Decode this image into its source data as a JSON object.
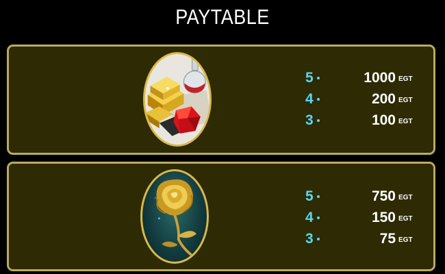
{
  "title": "PAYTABLE",
  "colors": {
    "background": "#000000",
    "panel": "#2d2a04",
    "panel_border": "#b9ab62",
    "count_accent": "#58d7f2",
    "text": "#ffffff"
  },
  "symbols": [
    {
      "icon": "gold-bars-ruby-symbol-icon",
      "payouts": [
        {
          "count": "5",
          "amount": "1000",
          "currency": "EGT"
        },
        {
          "count": "4",
          "amount": "200",
          "currency": "EGT"
        },
        {
          "count": "3",
          "amount": "100",
          "currency": "EGT"
        }
      ]
    },
    {
      "icon": "golden-rose-symbol-icon",
      "payouts": [
        {
          "count": "5",
          "amount": "750",
          "currency": "EGT"
        },
        {
          "count": "4",
          "amount": "150",
          "currency": "EGT"
        },
        {
          "count": "3",
          "amount": "75",
          "currency": "EGT"
        }
      ]
    }
  ]
}
